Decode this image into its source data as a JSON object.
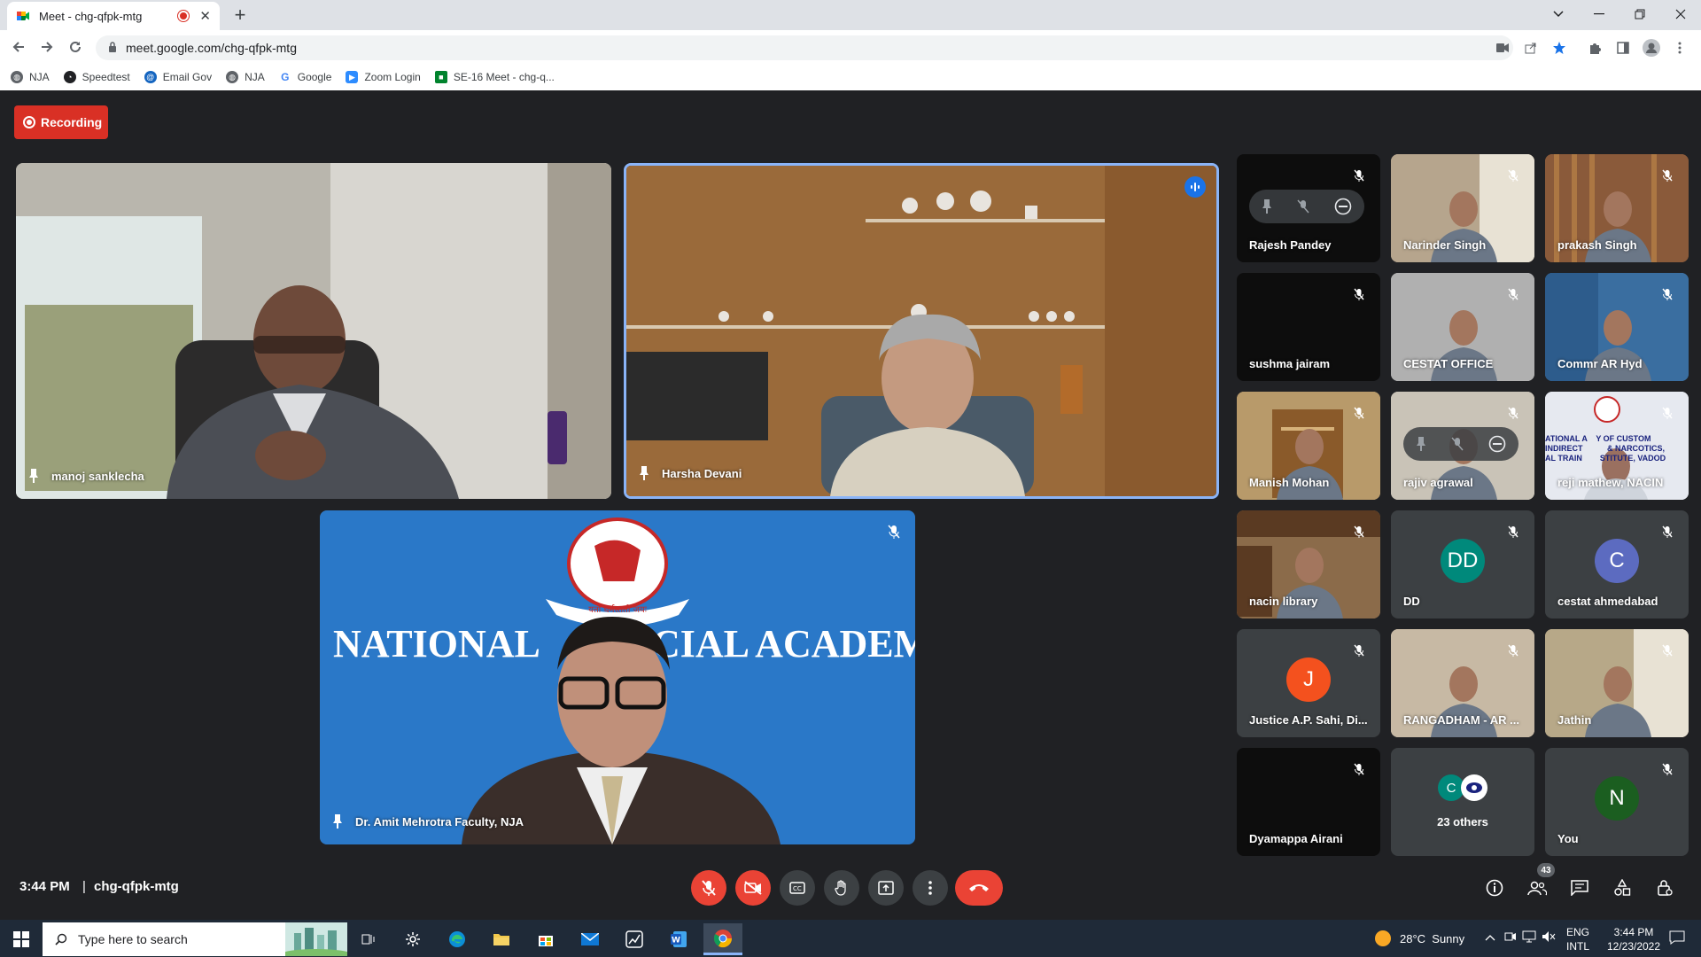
{
  "browser": {
    "tab_title": "Meet - chg-qfpk-mtg",
    "url": "meet.google.com/chg-qfpk-mtg",
    "bookmarks": [
      {
        "label": "NJA",
        "icon": "globe-icon"
      },
      {
        "label": "Speedtest",
        "icon": "speedtest-icon"
      },
      {
        "label": "Email Gov",
        "icon": "email-icon"
      },
      {
        "label": "NJA",
        "icon": "globe-icon"
      },
      {
        "label": "Google",
        "icon": "google-icon"
      },
      {
        "label": "Zoom Login",
        "icon": "zoom-icon"
      },
      {
        "label": "SE-16 Meet - chg-q...",
        "icon": "meet-icon"
      }
    ]
  },
  "meet": {
    "recording_label": "Recording",
    "main_tiles": [
      {
        "name": "manoj sanklecha"
      },
      {
        "name": "Harsha Devani"
      },
      {
        "name": "Dr. Amit Mehrotra Faculty, NJA"
      }
    ],
    "banner_text_left": "NATIONAL",
    "banner_text_right": "CIAL ACADEMY",
    "banner_seal_text": "यतो धर्मस्ततो जयः",
    "grid_tiles": [
      {
        "name": "Rajesh Pandey"
      },
      {
        "name": "Narinder Singh"
      },
      {
        "name": "prakash Singh"
      },
      {
        "name": "sushma jairam"
      },
      {
        "name": "CESTAT OFFICE"
      },
      {
        "name": "Commr AR Hyd"
      },
      {
        "name": "Manish Mohan"
      },
      {
        "name": "rajiv agrawal"
      },
      {
        "name": "reji mathew, NACIN",
        "overlay_text": "ATIONAL A    Y OF CUSTOM\nINDIRECT           & NARCOTICS,\nAL TRAIN        STITUTE, VADOD"
      },
      {
        "name": "nacin library"
      },
      {
        "name": "DD",
        "initial": "DD"
      },
      {
        "name": "cestat ahmedabad",
        "initial": "C"
      },
      {
        "name": "Justice A.P. Sahi, Di...",
        "initial": "J"
      },
      {
        "name": "RANGADHAM - AR ..."
      },
      {
        "name": "Jathin"
      },
      {
        "name": "Dyamappa Airani"
      },
      {
        "name": "23 others",
        "initial": "C"
      },
      {
        "name": "You",
        "initial": "N"
      }
    ],
    "time": "3:44 PM",
    "separator": "|",
    "meeting_code": "chg-qfpk-mtg",
    "people_count": "43"
  },
  "taskbar": {
    "search_placeholder": "Type here to search",
    "weather": "28°C  Sunny",
    "lang_top": "ENG",
    "lang_bottom": "INTL",
    "time": "3:44 PM",
    "date": "12/23/2022"
  },
  "colors": {
    "meet_bg": "#202124",
    "record_red": "#d93025",
    "avatar_dd": "#00897b",
    "avatar_c": "#5c6bc0",
    "avatar_j": "#f4511e",
    "avatar_n": "#1b5e20",
    "avatar_c_small": "#00897b",
    "speaking_blue": "#8ab4f8"
  }
}
